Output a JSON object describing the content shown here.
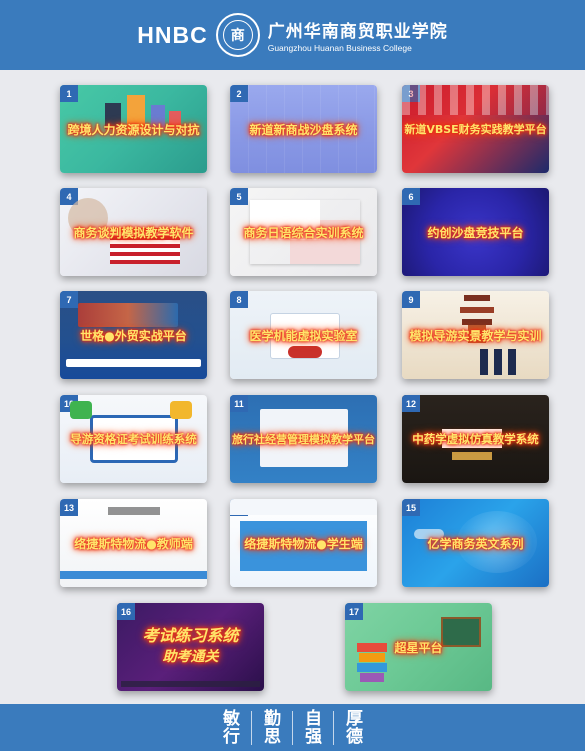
{
  "header": {
    "logo_text": "HNBC",
    "seal_glyph": "商",
    "college_cn": "广州华南商贸职业学院",
    "college_en": "Guangzhou Huanan Business College"
  },
  "cards": [
    {
      "num": "1",
      "title": "跨境人力资源设计与对抗"
    },
    {
      "num": "2",
      "title": "新道新商战沙盘系统"
    },
    {
      "num": "3",
      "title": "新道VBSE财务实践教学平台"
    },
    {
      "num": "4",
      "title": "商务谈判模拟教学软件"
    },
    {
      "num": "5",
      "title": "商务日语综合实训系统"
    },
    {
      "num": "6",
      "title": "约创沙盘竞技平台"
    },
    {
      "num": "7",
      "title": "世格●外贸实战平台"
    },
    {
      "num": "8",
      "title": "医学机能虚拟实验室"
    },
    {
      "num": "9",
      "title": "模拟导游实景教学与实训"
    },
    {
      "num": "10",
      "title": "导游资格证考试训练系统"
    },
    {
      "num": "11",
      "title": "旅行社经营管理模拟教学平台"
    },
    {
      "num": "12",
      "title": "中药学虚拟仿真教学系统"
    },
    {
      "num": "13",
      "title": "络捷斯特物流●教师端"
    },
    {
      "num": "14",
      "title": "络捷斯特物流●学生端"
    },
    {
      "num": "15",
      "title": "亿学商务英文系列"
    },
    {
      "num": "16",
      "title": "考试练习系统"
    },
    {
      "num": "17",
      "title": "超星平台"
    }
  ],
  "card16_subtitle": "助考通关",
  "footer": {
    "motto": [
      "敏行",
      "勤思",
      "自强",
      "厚德"
    ]
  },
  "colors": {
    "header_bg": "#3a7bbd",
    "page_bg": "#e9eaee",
    "badge": "#2f69b3",
    "title_text": "#ffe46a",
    "title_glow": "#ff3b1f"
  }
}
